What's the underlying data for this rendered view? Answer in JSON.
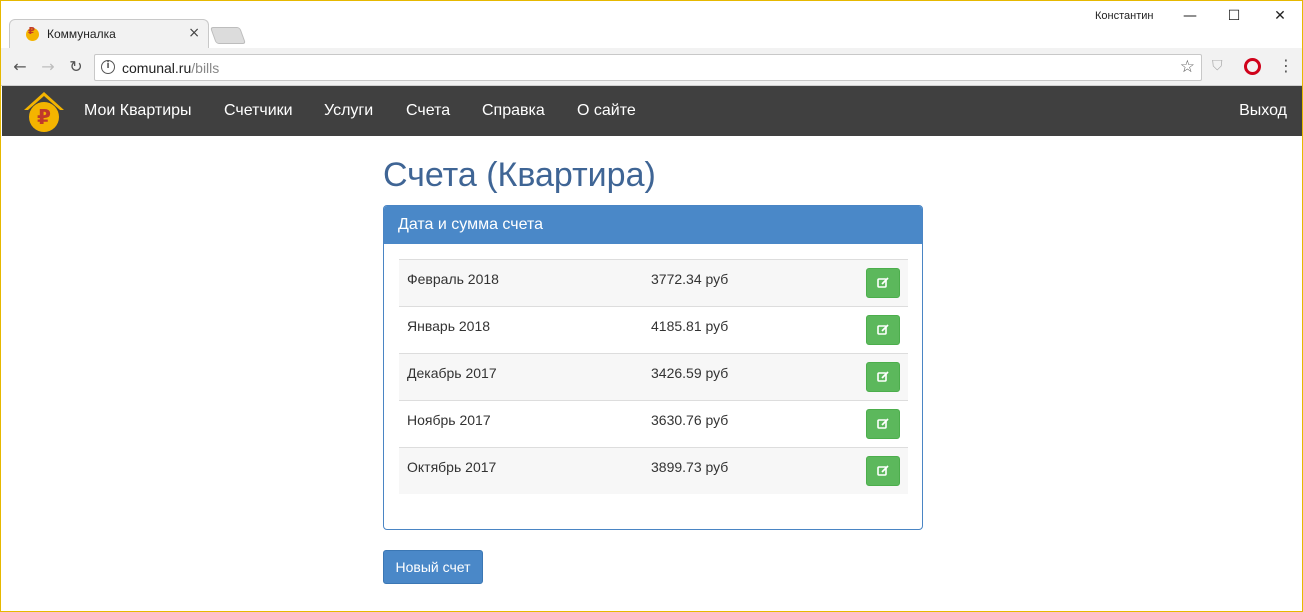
{
  "browser": {
    "tab_title": "Коммуналка",
    "tab_close": "×",
    "user_name": "Константин",
    "url_host": "comunal.ru",
    "url_path": "/bills",
    "icons": [
      "back-icon",
      "forward-icon",
      "reload-icon",
      "info-icon",
      "star-icon",
      "shield-icon",
      "opera-icon",
      "menu-icon"
    ]
  },
  "navbar": {
    "items": [
      "Мои Квартиры",
      "Счетчики",
      "Услуги",
      "Счета",
      "Справка",
      "О сайте"
    ],
    "logout": "Выход",
    "bg_color": "#404040"
  },
  "page": {
    "title": "Счета (Квартира)",
    "panel_heading": "Дата и сумма счета",
    "bills": [
      {
        "month": "Февраль 2018",
        "sum": "3772.34 руб"
      },
      {
        "month": "Январь 2018",
        "sum": "4185.81 руб"
      },
      {
        "month": "Декабрь 2017",
        "sum": "3426.59 руб"
      },
      {
        "month": "Ноябрь 2017",
        "sum": "3630.76 руб"
      },
      {
        "month": "Октябрь 2017",
        "sum": "3899.73 руб"
      }
    ],
    "new_bill_button": "Новый счет"
  },
  "colors": {
    "primary": "#4a88c8",
    "success": "#5cb85c",
    "title": "#3f6595"
  }
}
